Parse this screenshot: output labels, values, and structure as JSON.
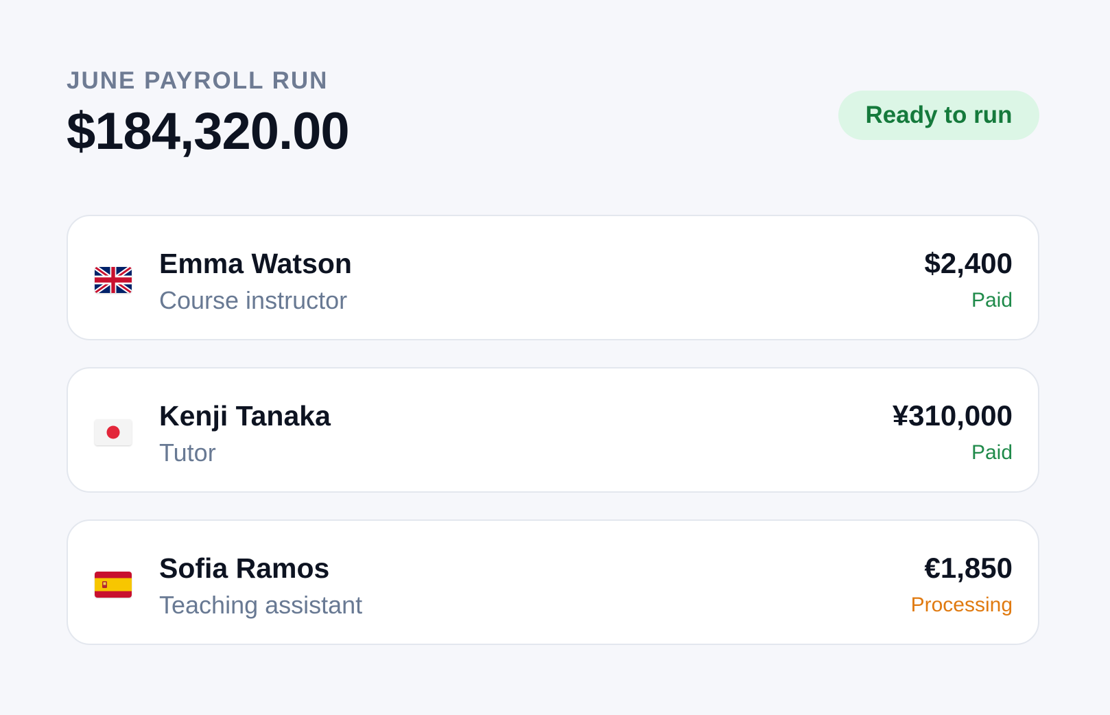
{
  "header": {
    "eyebrow": "JUNE PAYROLL RUN",
    "total": "$184,320.00"
  },
  "badge": {
    "label": "Ready to run",
    "bg_color": "#dcf6e6",
    "text_color": "#157a3c"
  },
  "payees": [
    {
      "name": "Emma Watson",
      "role": "Course instructor",
      "flag_icon": "uk-flag-icon",
      "amount": "$2,400",
      "status": "Paid",
      "status_color": "#1f8a4a"
    },
    {
      "name": "Kenji Tanaka",
      "role": "Tutor",
      "flag_icon": "japan-flag-icon",
      "amount": "¥310,000",
      "status": "Paid",
      "status_color": "#1f8a4a"
    },
    {
      "name": "Sofia Ramos",
      "role": "Teaching assistant",
      "flag_icon": "spain-flag-icon",
      "amount": "€1,850",
      "status": "Processing",
      "status_color": "#e07a10"
    }
  ]
}
